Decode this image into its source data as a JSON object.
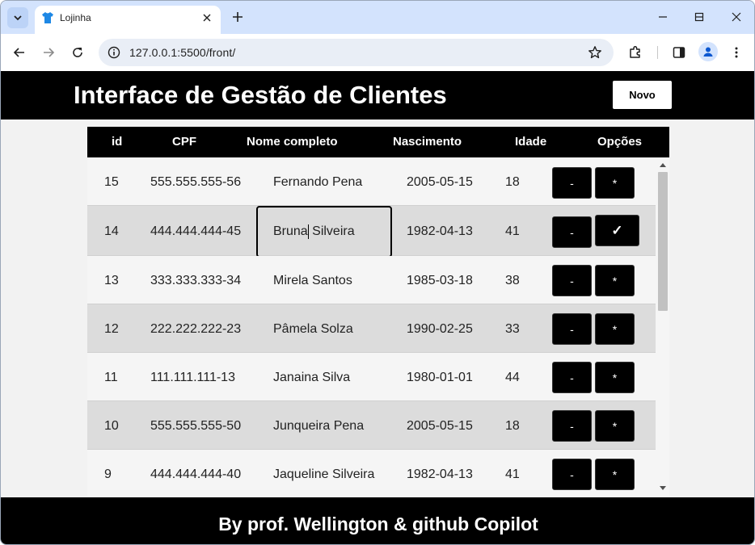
{
  "browser": {
    "tab_title": "Lojinha",
    "url": "127.0.0.1:5500/front/",
    "icons": {
      "tab_search": "chevron-down-icon",
      "favicon": "tshirt-icon",
      "tab_close": "close-icon",
      "new_tab": "plus-icon",
      "minimize": "minimize-icon",
      "maximize": "maximize-icon",
      "close_window": "close-icon",
      "back": "arrow-left-icon",
      "forward": "arrow-right-icon",
      "reload": "reload-icon",
      "site_info": "site-info-icon",
      "bookmark": "star-icon",
      "extensions": "puzzle-icon",
      "side_panel": "side-panel-icon",
      "profile": "person-icon",
      "menu": "kebab-menu-icon"
    },
    "accent": "#d3e3fd"
  },
  "header": {
    "title": "Interface de Gestão de Clientes",
    "new_button": "Novo"
  },
  "table": {
    "columns": [
      "id",
      "CPF",
      "Nome completo",
      "Nascimento",
      "Idade",
      "Opções"
    ],
    "rows": [
      {
        "id": "15",
        "cpf": "555.555.555-56",
        "nome": "Fernando Pena",
        "nascimento": "2005-05-15",
        "idade": "18",
        "btn_remove": "-",
        "btn_edit": "*"
      },
      {
        "id": "14",
        "cpf": "444.444.444-45",
        "nome_before_caret": "Bruna",
        "nome_after_caret": " Silveira",
        "nascimento": "1982-04-13",
        "idade": "41",
        "btn_remove": "-",
        "btn_edit": "✓",
        "editing": true
      },
      {
        "id": "13",
        "cpf": "333.333.333-34",
        "nome": "Mirela Santos",
        "nascimento": "1985-03-18",
        "idade": "38",
        "btn_remove": "-",
        "btn_edit": "*"
      },
      {
        "id": "12",
        "cpf": "222.222.222-23",
        "nome": "Pâmela Solza",
        "nascimento": "1990-02-25",
        "idade": "33",
        "btn_remove": "-",
        "btn_edit": "*"
      },
      {
        "id": "11",
        "cpf": "111.111.111-13",
        "nome": "Janaina Silva",
        "nascimento": "1980-01-01",
        "idade": "44",
        "btn_remove": "-",
        "btn_edit": "*"
      },
      {
        "id": "10",
        "cpf": "555.555.555-50",
        "nome": "Junqueira Pena",
        "nascimento": "2005-05-15",
        "idade": "18",
        "btn_remove": "-",
        "btn_edit": "*"
      },
      {
        "id": "9",
        "cpf": "444.444.444-40",
        "nome": "Jaqueline Silveira",
        "nascimento": "1982-04-13",
        "idade": "41",
        "btn_remove": "-",
        "btn_edit": "*"
      }
    ],
    "row_colors": {
      "even": "#f5f5f5",
      "odd": "#dcdcdc"
    }
  },
  "footer": {
    "text": "By prof. Wellington & github Copilot"
  }
}
